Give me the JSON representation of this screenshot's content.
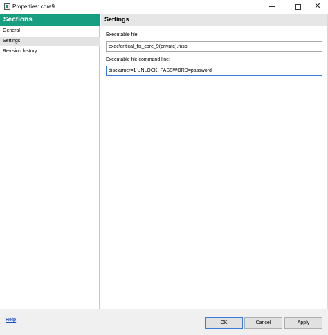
{
  "window": {
    "title": "Properties: core9",
    "app_icon": "properties-window-icon",
    "controls": {
      "minimize": "minimize-icon",
      "maximize": "maximize-icon",
      "close_glyph": "✕"
    }
  },
  "sidebar": {
    "header": "Sections",
    "items": [
      {
        "label": "General",
        "selected": false
      },
      {
        "label": "Settings",
        "selected": true
      },
      {
        "label": "Revision history",
        "selected": false
      }
    ]
  },
  "settings": {
    "header": "Settings",
    "executable_file": {
      "label": "Executable file:",
      "value": "exec\\critical_fix_core_9(private).msp"
    },
    "command_line": {
      "label": "Executable file command line:",
      "value": "disclaimer=1 UNLOCK_PASSWORD=password"
    }
  },
  "footer": {
    "help": "Help",
    "ok": "OK",
    "cancel": "Cancel",
    "apply": "Apply"
  },
  "colors": {
    "sections_header_bg": "#1a9e82",
    "selected_item_bg": "#e3e3e3",
    "focus_border": "#3a7bd5",
    "help_link": "#1a4fb8"
  }
}
